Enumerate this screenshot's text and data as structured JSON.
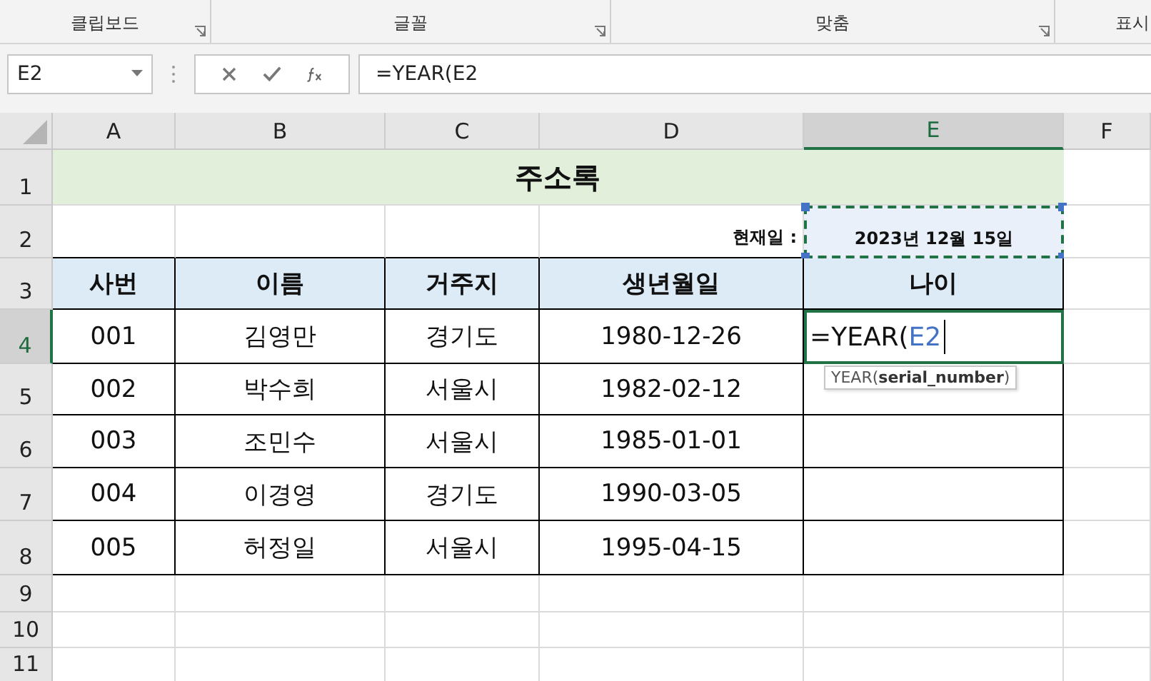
{
  "ribbon_groups": [
    {
      "label": "클립보드",
      "launcher": true
    },
    {
      "label": "글꼴",
      "launcher": true
    },
    {
      "label": "맞춤",
      "launcher": true
    },
    {
      "label": "표시",
      "launcher": false
    }
  ],
  "name_box": "E2",
  "formula": "=YEAR(E2",
  "columns": [
    {
      "label": "A",
      "selected": false
    },
    {
      "label": "B",
      "selected": false
    },
    {
      "label": "C",
      "selected": false
    },
    {
      "label": "D",
      "selected": false
    },
    {
      "label": "E",
      "selected": true
    },
    {
      "label": "F",
      "selected": false
    }
  ],
  "rows": [
    {
      "label": "1",
      "selected": false
    },
    {
      "label": "2",
      "selected": false
    },
    {
      "label": "3",
      "selected": false
    },
    {
      "label": "4",
      "selected": true
    },
    {
      "label": "5",
      "selected": false
    },
    {
      "label": "6",
      "selected": false
    },
    {
      "label": "7",
      "selected": false
    },
    {
      "label": "8",
      "selected": false
    },
    {
      "label": "9",
      "selected": false
    },
    {
      "label": "10",
      "selected": false
    },
    {
      "label": "11",
      "selected": false
    }
  ],
  "title": "주소록",
  "date_label": "현재일 :",
  "date_value": "2023년 12월 15일",
  "table": {
    "headers": [
      "사번",
      "이름",
      "거주지",
      "생년월일",
      "나이"
    ],
    "rows": [
      {
        "cells": [
          "001",
          "김영만",
          "경기도",
          "1980-12-26"
        ],
        "editing": {
          "text": "=YEAR(",
          "reference": "E2"
        }
      },
      {
        "cells": [
          "002",
          "박수희",
          "서울시",
          "1982-02-12"
        ]
      },
      {
        "cells": [
          "003",
          "조민수",
          "서울시",
          "1985-01-01"
        ]
      },
      {
        "cells": [
          "004",
          "이경영",
          "경기도",
          "1990-03-05"
        ]
      },
      {
        "cells": [
          "005",
          "허정일",
          "서울시",
          "1995-04-15"
        ]
      }
    ]
  },
  "tooltip": "YEAR(**serial_number**)"
}
